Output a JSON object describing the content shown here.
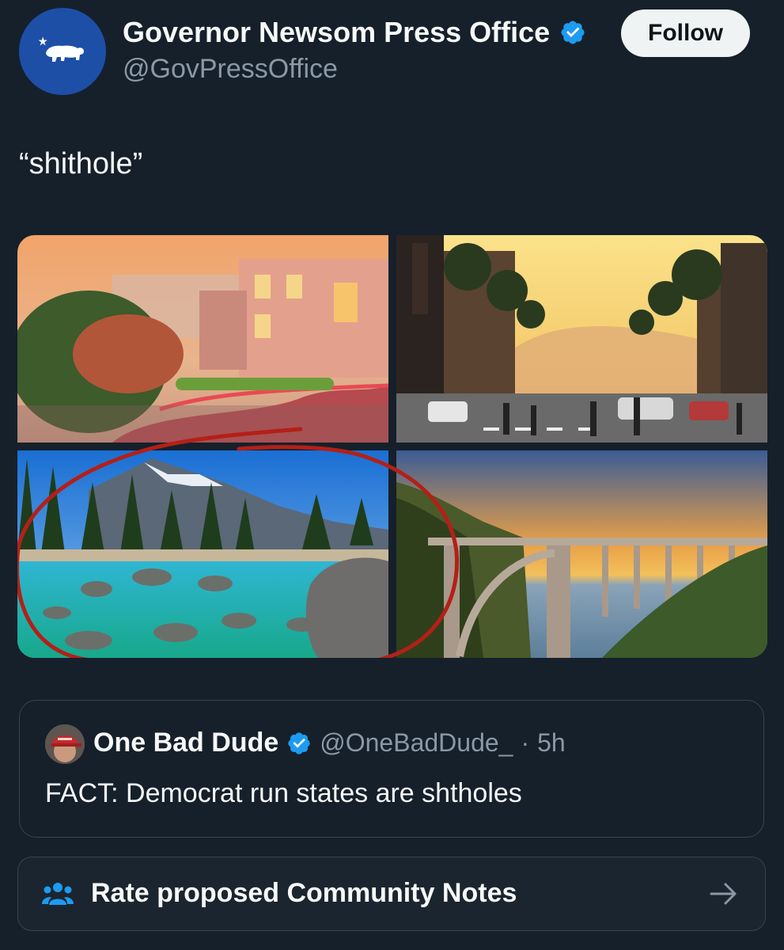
{
  "author": {
    "display_name": "Governor Newsom Press Office",
    "handle": "@GovPressOffice",
    "verified": true,
    "avatar_icon": "california-bear-flag-icon"
  },
  "follow_button": {
    "label": "Follow"
  },
  "tweet": {
    "text": "“shithole”",
    "media": [
      {
        "icon": "photo-lombard-street-san-francisco"
      },
      {
        "icon": "photo-hollywood-boulevard-street"
      },
      {
        "icon": "photo-lake-tahoe-shoreline"
      },
      {
        "icon": "photo-bixby-bridge-coast"
      }
    ]
  },
  "quote": {
    "name": "One Bad Dude",
    "handle": "@OneBadDude_",
    "separator": "·",
    "time": "5h",
    "verified": true,
    "text": "FACT: Democrat run states are shtholes"
  },
  "community_notes": {
    "label": "Rate proposed Community Notes",
    "icon": "people-icon",
    "arrow_icon": "arrow-right-icon"
  },
  "colors": {
    "background": "#15202b",
    "verified_blue": "#1d9bf0",
    "annotation_red": "#b32018"
  }
}
